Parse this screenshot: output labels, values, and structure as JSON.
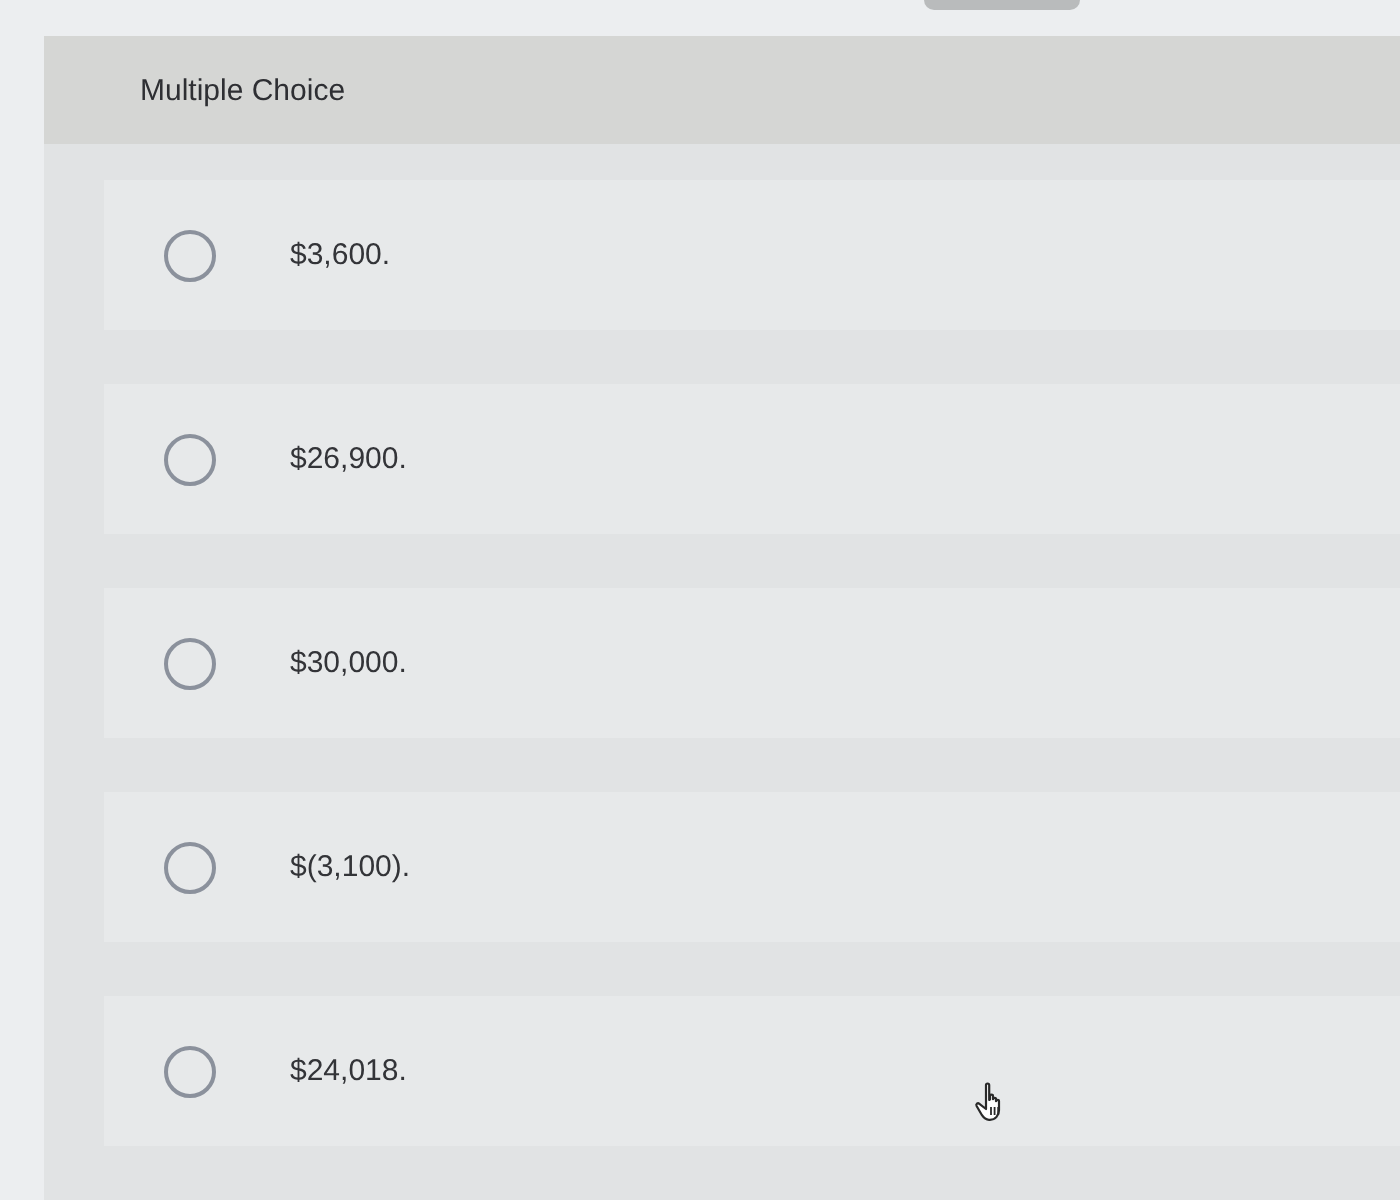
{
  "header": {
    "title": "Multiple Choice"
  },
  "options": [
    {
      "label": "$3,600.",
      "selected": false
    },
    {
      "label": "$26,900.",
      "selected": false
    },
    {
      "label": "$30,000.",
      "selected": false
    },
    {
      "label": "$(3,100).",
      "selected": false
    },
    {
      "label": "$24,018.",
      "selected": false
    }
  ]
}
